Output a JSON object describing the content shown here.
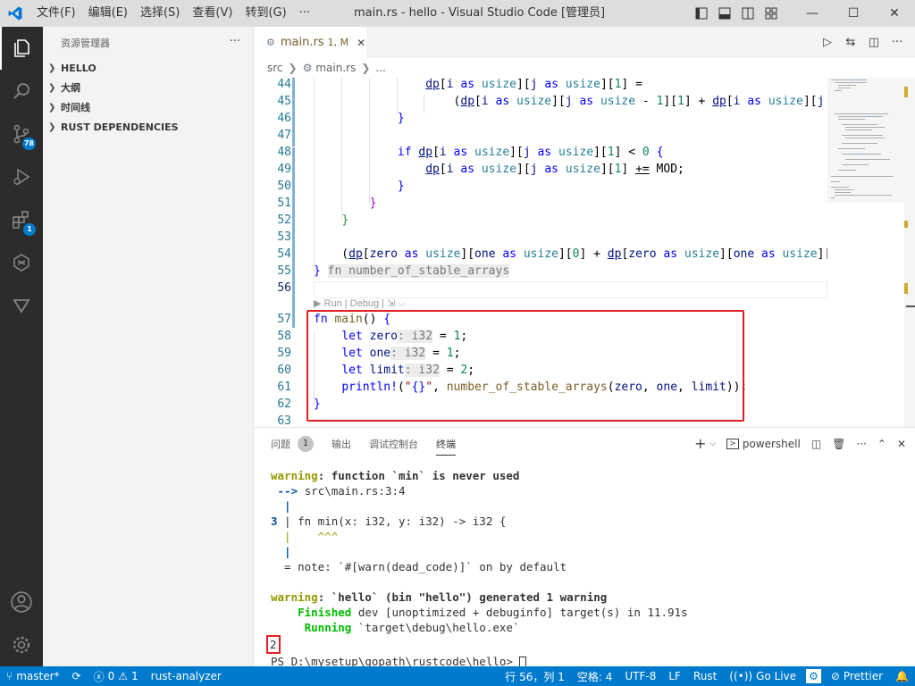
{
  "titlebar": {
    "menu": [
      "文件(F)",
      "编辑(E)",
      "选择(S)",
      "查看(V)",
      "转到(G)",
      "···"
    ],
    "title": "main.rs - hello - Visual Studio Code [管理员]",
    "min": "—",
    "max": "☐",
    "close": "✕"
  },
  "activity": {
    "badges": {
      "scm": "78",
      "extensions": "1"
    }
  },
  "sidebar": {
    "title": "资源管理器",
    "more": "···",
    "sections": [
      "HELLO",
      "大纲",
      "时间线",
      "RUST DEPENDENCIES"
    ]
  },
  "tab": {
    "name": "main.rs",
    "status": "1, M",
    "close": "✕"
  },
  "breadcrumb": {
    "folder": "src",
    "file": "main.rs",
    "more": "..."
  },
  "code": {
    "lines": [
      {
        "n": "44",
        "html_key": 0
      },
      {
        "n": "45",
        "html_key": 1
      },
      {
        "n": "46",
        "html_key": 2
      },
      {
        "n": "47",
        "html_key": 3
      },
      {
        "n": "48",
        "html_key": 4
      },
      {
        "n": "49",
        "html_key": 5
      },
      {
        "n": "50",
        "html_key": 6
      },
      {
        "n": "51",
        "html_key": 7
      },
      {
        "n": "52",
        "html_key": 8
      },
      {
        "n": "53",
        "html_key": 9
      },
      {
        "n": "54",
        "html_key": 10
      },
      {
        "n": "55",
        "html_key": 11
      },
      {
        "n": "56",
        "html_key": 12
      }
    ],
    "codelens": "▶ Run | Debug | ⇲ ⌵",
    "main_lines": [
      "57",
      "58",
      "59",
      "60",
      "61",
      "62",
      "63"
    ]
  },
  "panel": {
    "tabs": [
      "问题",
      "输出",
      "调试控制台",
      "终端"
    ],
    "problems_count": "1",
    "shell": "powershell",
    "terminal": {
      "warn1": "warning",
      "warn1_msg": ": function `min` is never used",
      "arrow": " --> ",
      "loc": "src\\main.rs:3:4",
      "bar1": "  |",
      "line3_num": "3",
      "line3_code": " | fn min(x: i32, y: i32) -> i32 {",
      "carets": "  |    ^^^",
      "bar2": "  |",
      "note": "  = note: `#[warn(dead_code)]` on by default",
      "warn2": "warning",
      "warn2_msg": ": `hello` (bin \"hello\") generated 1 warning",
      "finished_label": "    Finished",
      "finished_msg": " dev [unoptimized + debuginfo] target(s) in 11.91s",
      "running_label": "     Running",
      "running_msg": " `target\\debug\\hello.exe`",
      "output": "2",
      "prompt": "PS D:\\mysetup\\gopath\\rustcode\\hello> "
    }
  },
  "statusbar": {
    "branch": "master*",
    "errors": "0",
    "warnings": "1",
    "analyzer": "rust-analyzer",
    "position": "行 56，列 1",
    "spaces": "空格: 4",
    "encoding": "UTF-8",
    "eol": "LF",
    "language": "Rust",
    "golive": "Go Live",
    "prettier": "Prettier"
  }
}
